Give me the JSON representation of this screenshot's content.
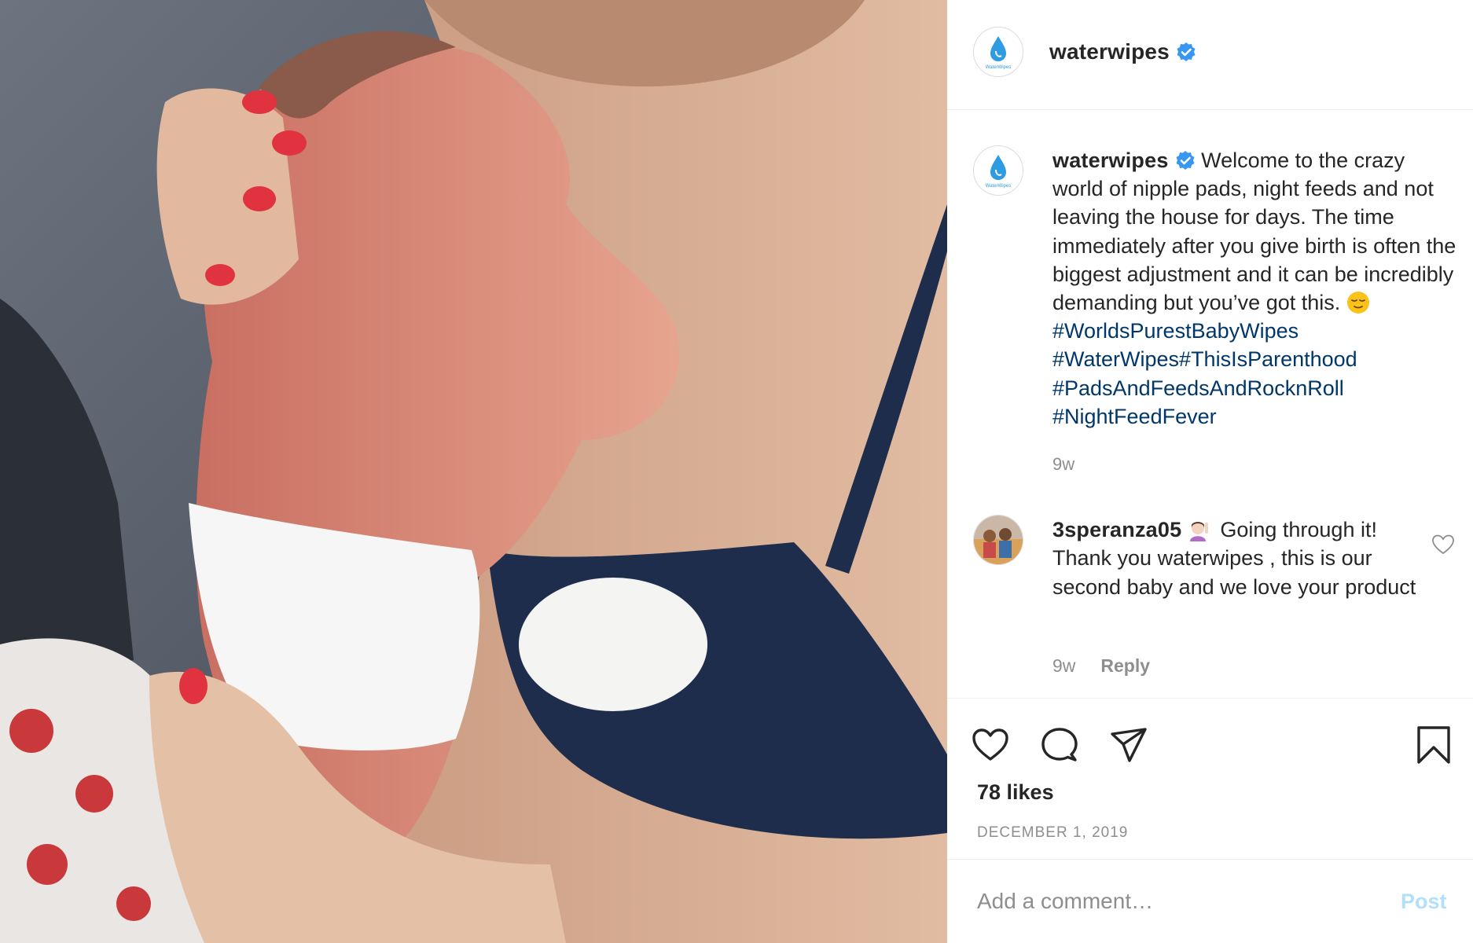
{
  "post": {
    "author": "waterwipes",
    "verified_icon": "verified-badge-icon",
    "likes_text": "78 likes",
    "date_text": "DECEMBER 1, 2019"
  },
  "caption": {
    "username": "waterwipes",
    "text_1": "Welcome to the crazy world of nipple pads, night feeds and not leaving the house for days. The time immediately after you give birth is often the biggest adjustment and it can be incredibly demanding but you’ve got this.",
    "emoji": "relieved-face-emoji",
    "hashtag_1": "#WorldsPurestBabyWipes",
    "hashtag_2": "#WaterWipes",
    "hashtag_3": "#ThisIsParenthood",
    "hashtag_4": "#PadsAndFeedsAndRocknRoll",
    "hashtag_5": "#NightFeedFever",
    "time": "9w"
  },
  "comment": {
    "username": "3speranza05",
    "emoji": "woman-raising-hand-emoji",
    "text": "Going through it! Thank you waterwipes , this is our second baby and we love your product",
    "time": "9w",
    "reply_label": "Reply"
  },
  "actions": {
    "like_icon": "heart-icon",
    "comment_icon": "comment-icon",
    "share_icon": "paper-plane-icon",
    "save_icon": "bookmark-icon"
  },
  "add_comment": {
    "placeholder": "Add a comment…",
    "post_label": "Post"
  },
  "logo_text": "WaterWipes",
  "colors": {
    "verified_blue": "#3897f0",
    "hashtag": "#00376b",
    "muted": "#8e8e8e",
    "post_button_disabled": "#b2dffc",
    "logo_drop": "#2f9be0"
  }
}
